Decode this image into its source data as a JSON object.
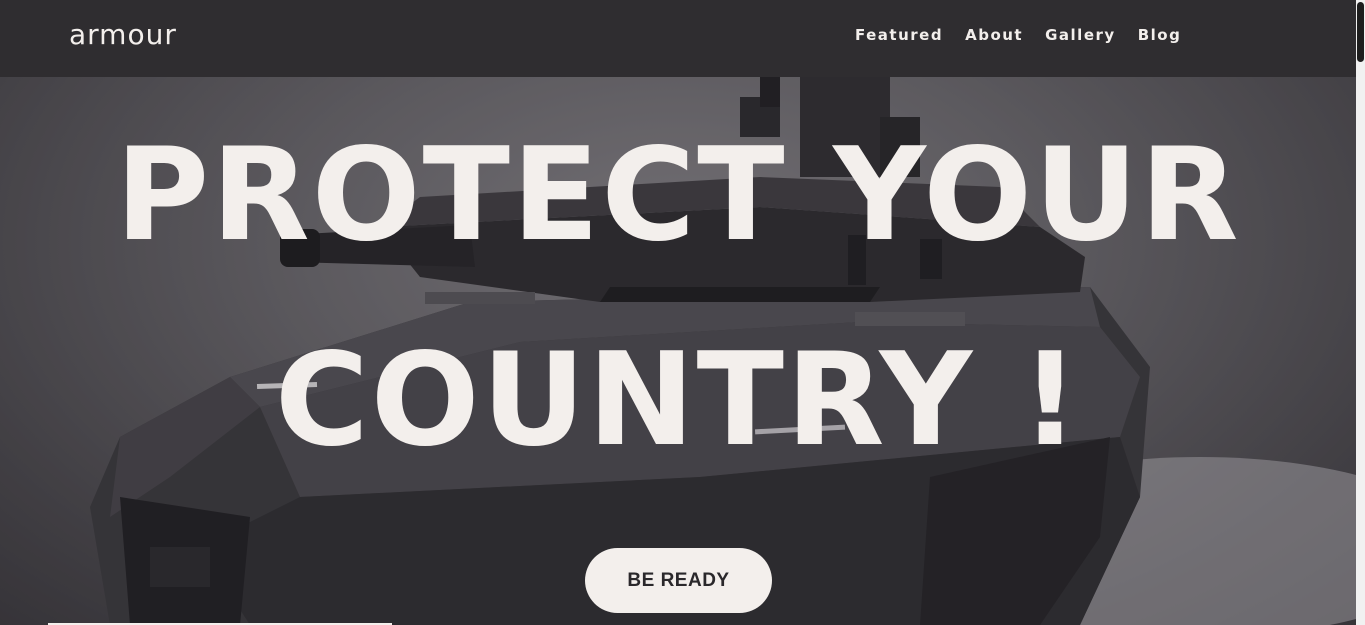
{
  "header": {
    "logo": "armour",
    "nav": [
      {
        "label": "Featured"
      },
      {
        "label": "About"
      },
      {
        "label": "Gallery"
      },
      {
        "label": "Blog"
      }
    ]
  },
  "hero": {
    "headline_line1": "PROTECT YOUR",
    "headline_line2": "COUNTRY !",
    "cta_label": "BE READY",
    "image_subject": "tank"
  },
  "colors": {
    "nav_bg": "#2f2d30",
    "text": "#f3efec",
    "button_bg": "#f3efec",
    "button_text": "#2a282b"
  }
}
